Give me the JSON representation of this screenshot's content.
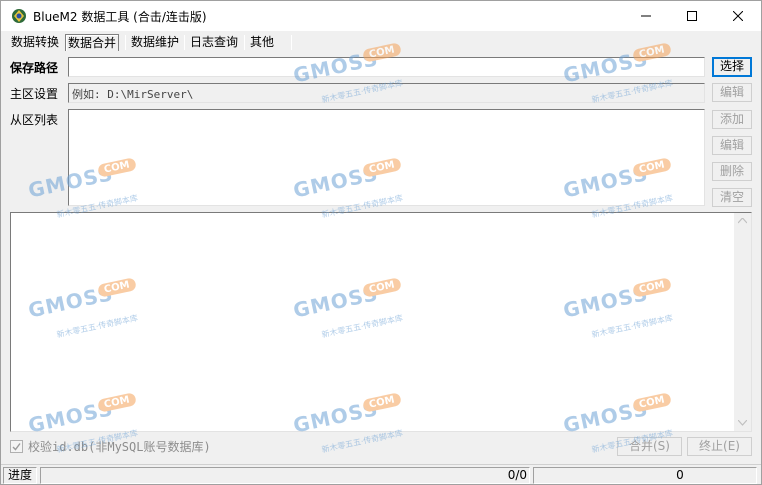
{
  "window": {
    "title": "BlueM2 数据工具 (合击/连击版)"
  },
  "menu": {
    "items": [
      {
        "label": "数据转换"
      },
      {
        "label": "数据合并"
      },
      {
        "label": "数据维护"
      },
      {
        "label": "日志查询"
      },
      {
        "label": "其他"
      }
    ]
  },
  "form": {
    "save_path_label": "保存路径",
    "save_path_value": "",
    "main_server_label": "主区设置",
    "main_server_placeholder": "例如: D:\\MirServer\\",
    "sub_list_label": "从区列表"
  },
  "buttons": {
    "select": "选择",
    "edit_main": "编辑",
    "add": "添加",
    "edit_list": "编辑",
    "delete": "删除",
    "clear": "清空",
    "merge": "合并(S)",
    "stop": "终止(E)"
  },
  "options": {
    "verify_label": "校验id.db(非MySQL账号数据库)",
    "verify_checked": true
  },
  "status": {
    "progress_label": "进度",
    "progress_count": "0/0",
    "total": "0"
  },
  "watermark": {
    "brand": "GMOSS",
    "badge": "COM",
    "tagline": "新木零五五·传奇脚本库"
  }
}
